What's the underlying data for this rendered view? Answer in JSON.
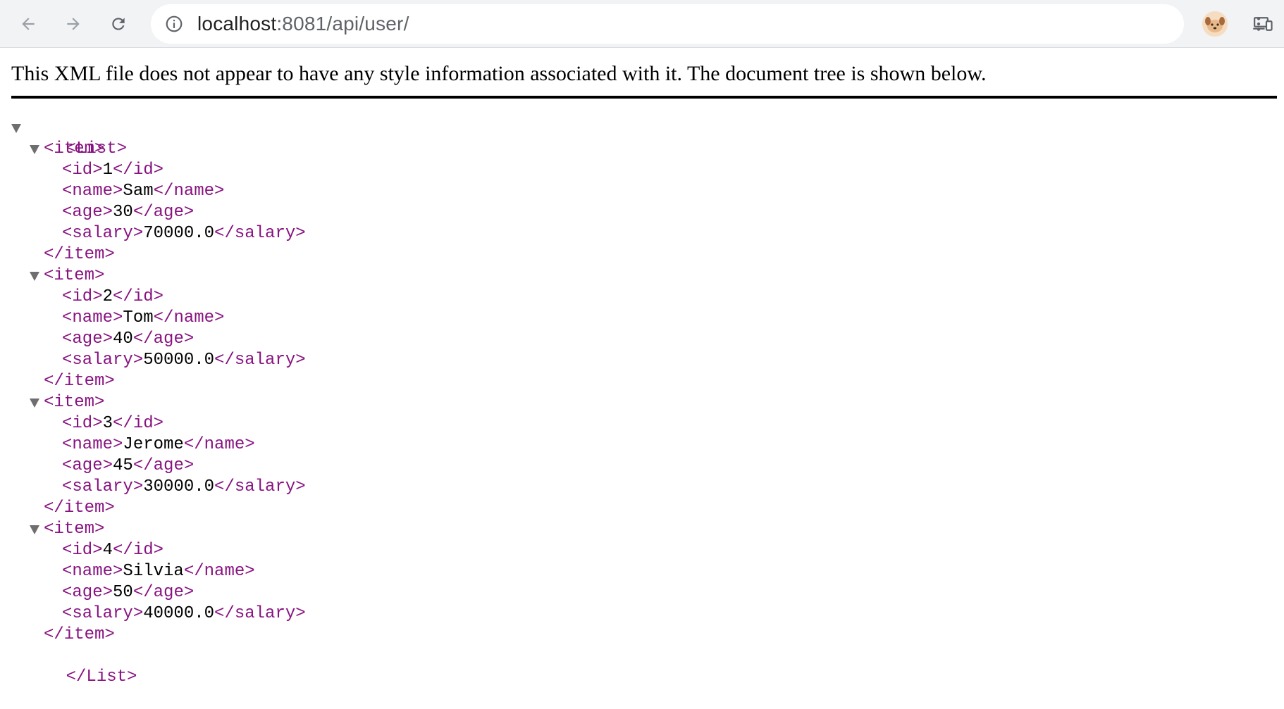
{
  "browser": {
    "url_host": "localhost",
    "url_rest": ":8081/api/user/",
    "icons": {
      "back": "arrow-left-icon",
      "forward": "arrow-right-icon",
      "reload": "reload-icon",
      "site_info": "info-circle-icon",
      "cast": "cast-devices-icon",
      "bookmark": "star-icon",
      "profile": "avatar-icon",
      "menu": "more-vert-icon"
    }
  },
  "xml_viewer": {
    "header_text": "This XML file does not appear to have any style information associated with it. The document tree is shown below.",
    "root_open": "<List>",
    "root_close": "</List>",
    "item_open": "<item>",
    "item_close": "</item>",
    "items": [
      {
        "id": "1",
        "name": "Sam",
        "age": "30",
        "salary": "70000.0"
      },
      {
        "id": "2",
        "name": "Tom",
        "age": "40",
        "salary": "50000.0"
      },
      {
        "id": "3",
        "name": "Jerome",
        "age": "45",
        "salary": "30000.0"
      },
      {
        "id": "4",
        "name": "Silvia",
        "age": "50",
        "salary": "40000.0"
      }
    ],
    "fields": [
      "id",
      "name",
      "age",
      "salary"
    ]
  },
  "colors": {
    "tag": "#881280",
    "text": "#000000",
    "toolbar_bg": "#f1f3f4"
  }
}
